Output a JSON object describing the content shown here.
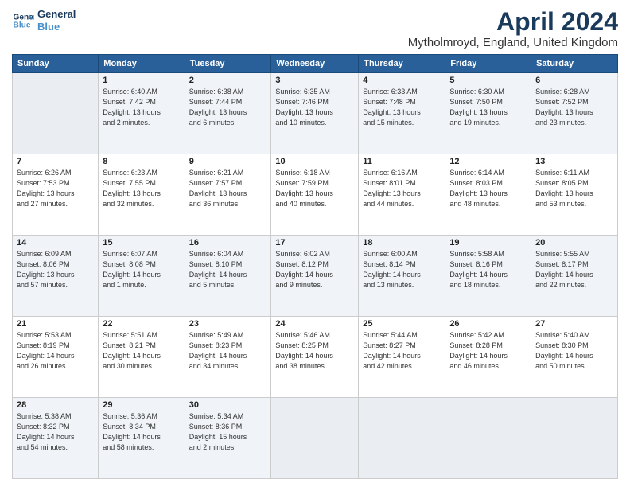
{
  "header": {
    "logo_line1": "General",
    "logo_line2": "Blue",
    "month": "April 2024",
    "location": "Mytholmroyd, England, United Kingdom"
  },
  "days_of_week": [
    "Sunday",
    "Monday",
    "Tuesday",
    "Wednesday",
    "Thursday",
    "Friday",
    "Saturday"
  ],
  "weeks": [
    [
      {
        "day": "",
        "info": ""
      },
      {
        "day": "1",
        "info": "Sunrise: 6:40 AM\nSunset: 7:42 PM\nDaylight: 13 hours\nand 2 minutes."
      },
      {
        "day": "2",
        "info": "Sunrise: 6:38 AM\nSunset: 7:44 PM\nDaylight: 13 hours\nand 6 minutes."
      },
      {
        "day": "3",
        "info": "Sunrise: 6:35 AM\nSunset: 7:46 PM\nDaylight: 13 hours\nand 10 minutes."
      },
      {
        "day": "4",
        "info": "Sunrise: 6:33 AM\nSunset: 7:48 PM\nDaylight: 13 hours\nand 15 minutes."
      },
      {
        "day": "5",
        "info": "Sunrise: 6:30 AM\nSunset: 7:50 PM\nDaylight: 13 hours\nand 19 minutes."
      },
      {
        "day": "6",
        "info": "Sunrise: 6:28 AM\nSunset: 7:52 PM\nDaylight: 13 hours\nand 23 minutes."
      }
    ],
    [
      {
        "day": "7",
        "info": "Sunrise: 6:26 AM\nSunset: 7:53 PM\nDaylight: 13 hours\nand 27 minutes."
      },
      {
        "day": "8",
        "info": "Sunrise: 6:23 AM\nSunset: 7:55 PM\nDaylight: 13 hours\nand 32 minutes."
      },
      {
        "day": "9",
        "info": "Sunrise: 6:21 AM\nSunset: 7:57 PM\nDaylight: 13 hours\nand 36 minutes."
      },
      {
        "day": "10",
        "info": "Sunrise: 6:18 AM\nSunset: 7:59 PM\nDaylight: 13 hours\nand 40 minutes."
      },
      {
        "day": "11",
        "info": "Sunrise: 6:16 AM\nSunset: 8:01 PM\nDaylight: 13 hours\nand 44 minutes."
      },
      {
        "day": "12",
        "info": "Sunrise: 6:14 AM\nSunset: 8:03 PM\nDaylight: 13 hours\nand 48 minutes."
      },
      {
        "day": "13",
        "info": "Sunrise: 6:11 AM\nSunset: 8:05 PM\nDaylight: 13 hours\nand 53 minutes."
      }
    ],
    [
      {
        "day": "14",
        "info": "Sunrise: 6:09 AM\nSunset: 8:06 PM\nDaylight: 13 hours\nand 57 minutes."
      },
      {
        "day": "15",
        "info": "Sunrise: 6:07 AM\nSunset: 8:08 PM\nDaylight: 14 hours\nand 1 minute."
      },
      {
        "day": "16",
        "info": "Sunrise: 6:04 AM\nSunset: 8:10 PM\nDaylight: 14 hours\nand 5 minutes."
      },
      {
        "day": "17",
        "info": "Sunrise: 6:02 AM\nSunset: 8:12 PM\nDaylight: 14 hours\nand 9 minutes."
      },
      {
        "day": "18",
        "info": "Sunrise: 6:00 AM\nSunset: 8:14 PM\nDaylight: 14 hours\nand 13 minutes."
      },
      {
        "day": "19",
        "info": "Sunrise: 5:58 AM\nSunset: 8:16 PM\nDaylight: 14 hours\nand 18 minutes."
      },
      {
        "day": "20",
        "info": "Sunrise: 5:55 AM\nSunset: 8:17 PM\nDaylight: 14 hours\nand 22 minutes."
      }
    ],
    [
      {
        "day": "21",
        "info": "Sunrise: 5:53 AM\nSunset: 8:19 PM\nDaylight: 14 hours\nand 26 minutes."
      },
      {
        "day": "22",
        "info": "Sunrise: 5:51 AM\nSunset: 8:21 PM\nDaylight: 14 hours\nand 30 minutes."
      },
      {
        "day": "23",
        "info": "Sunrise: 5:49 AM\nSunset: 8:23 PM\nDaylight: 14 hours\nand 34 minutes."
      },
      {
        "day": "24",
        "info": "Sunrise: 5:46 AM\nSunset: 8:25 PM\nDaylight: 14 hours\nand 38 minutes."
      },
      {
        "day": "25",
        "info": "Sunrise: 5:44 AM\nSunset: 8:27 PM\nDaylight: 14 hours\nand 42 minutes."
      },
      {
        "day": "26",
        "info": "Sunrise: 5:42 AM\nSunset: 8:28 PM\nDaylight: 14 hours\nand 46 minutes."
      },
      {
        "day": "27",
        "info": "Sunrise: 5:40 AM\nSunset: 8:30 PM\nDaylight: 14 hours\nand 50 minutes."
      }
    ],
    [
      {
        "day": "28",
        "info": "Sunrise: 5:38 AM\nSunset: 8:32 PM\nDaylight: 14 hours\nand 54 minutes."
      },
      {
        "day": "29",
        "info": "Sunrise: 5:36 AM\nSunset: 8:34 PM\nDaylight: 14 hours\nand 58 minutes."
      },
      {
        "day": "30",
        "info": "Sunrise: 5:34 AM\nSunset: 8:36 PM\nDaylight: 15 hours\nand 2 minutes."
      },
      {
        "day": "",
        "info": ""
      },
      {
        "day": "",
        "info": ""
      },
      {
        "day": "",
        "info": ""
      },
      {
        "day": "",
        "info": ""
      }
    ]
  ]
}
